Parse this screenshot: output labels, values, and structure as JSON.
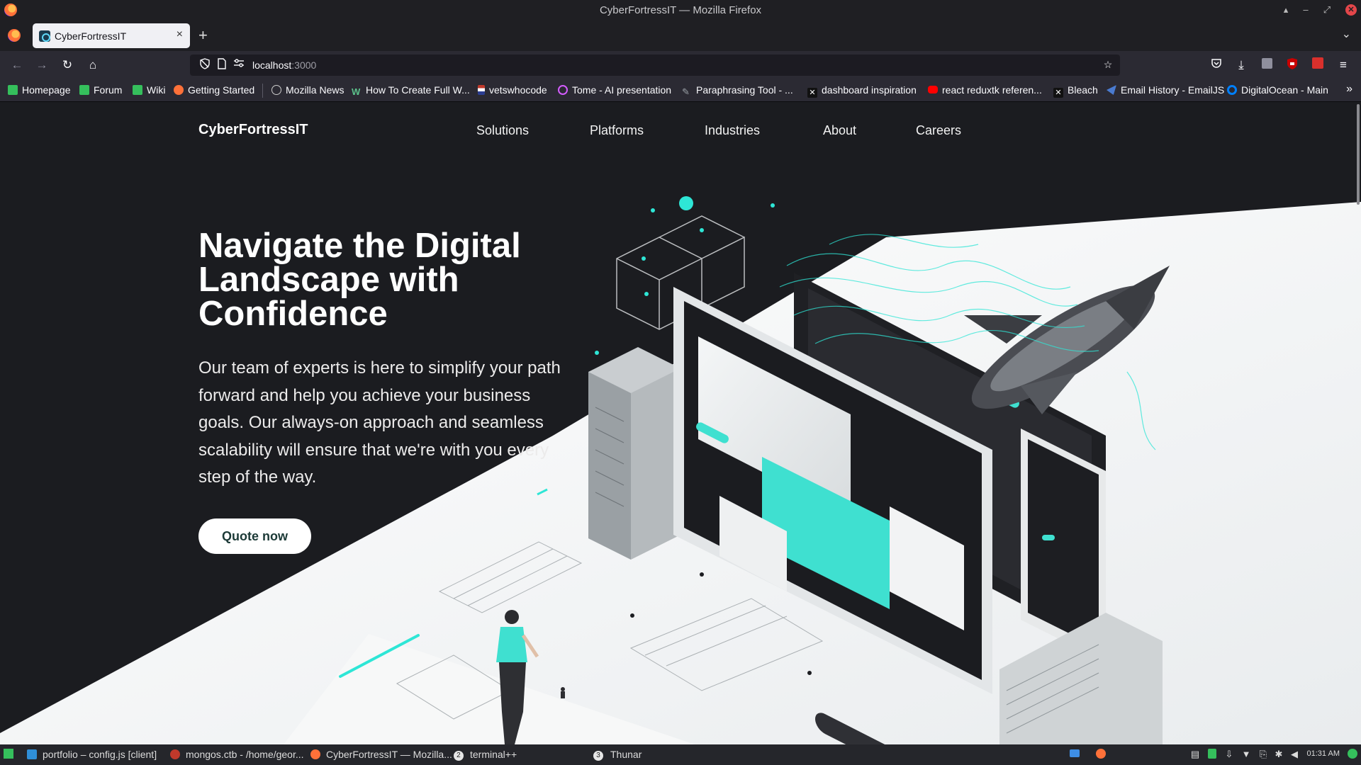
{
  "window": {
    "title": "CyberFortressIT — Mozilla Firefox",
    "controls": [
      "▴",
      "–",
      "⤢",
      "✕"
    ]
  },
  "tabs": [
    {
      "label": "CyberFortressIT",
      "favicon": "react-logo-icon",
      "active": true
    }
  ],
  "toolbar": {
    "back": "←",
    "forward": "→",
    "reload": "↻",
    "home": "⌂",
    "new_tab": "+",
    "tab_list": "⌄"
  },
  "urlbar": {
    "host": "localhost",
    "port": ":3000"
  },
  "bookmarks": [
    {
      "label": "Homepage",
      "icon": "manjaro-icon",
      "color": "#35bf5c"
    },
    {
      "label": "Forum",
      "icon": "manjaro-icon",
      "color": "#35bf5c"
    },
    {
      "label": "Wiki",
      "icon": "manjaro-icon",
      "color": "#35bf5c"
    },
    {
      "label": "Getting Started",
      "icon": "firefox-icon",
      "color": "#ff7139"
    },
    {
      "label": "Mozilla News",
      "icon": "globe-icon",
      "color": "#cccccc"
    },
    {
      "label": "How To Create Full W...",
      "icon": "w-icon",
      "color": "#5cc28b"
    },
    {
      "label": "vetswhocode",
      "icon": "flag-icon",
      "color": "#c0392b"
    },
    {
      "label": "Tome - AI presentation",
      "icon": "tome-icon",
      "color": "#d45cff"
    },
    {
      "label": "Paraphrasing Tool - ...",
      "icon": "quill-icon",
      "color": "#9aa0a6"
    },
    {
      "label": "dashboard inspiration",
      "icon": "x-icon",
      "color": "#111111"
    },
    {
      "label": "react reduxtk referen...",
      "icon": "youtube-icon",
      "color": "#ff0000"
    },
    {
      "label": "Bleach",
      "icon": "x-icon",
      "color": "#111111"
    },
    {
      "label": "Email History - EmailJS",
      "icon": "emailjs-icon",
      "color": "#4a7bd0"
    },
    {
      "label": "DigitalOcean - Main",
      "icon": "digitalocean-icon",
      "color": "#0080ff"
    }
  ],
  "site": {
    "brand": "CyberFortressIT",
    "nav": [
      "Solutions",
      "Platforms",
      "Industries",
      "About",
      "Careers"
    ],
    "hero_title": "Navigate the Digital Landscape with Confidence",
    "hero_text": "Our team of experts is here to simplify your path forward and help you achieve your business goals. Our always-on approach and seamless scalability will ensure that we're with you every step of the way.",
    "cta": "Quote now",
    "accent": "#2ee6d6"
  },
  "taskbar": {
    "tasks": [
      {
        "label": "portfolio – config.js [client]",
        "icon": "vscode-icon",
        "color": "#2f8fd8"
      },
      {
        "label": "mongos.ctb - /home/geor...",
        "icon": "cherrytree-icon",
        "color": "#c0392b"
      },
      {
        "label": "CyberFortressIT — Mozilla...",
        "icon": "firefox-icon",
        "color": "#ff7139",
        "badge": "2"
      },
      {
        "label": "terminal++",
        "icon": "terminal-icon",
        "color": "#dcdcdc"
      },
      {
        "label": "Thunar",
        "icon": "folder-icon",
        "color": "#dcdcdc",
        "badge_prefix": "3"
      }
    ],
    "clock": "01:31 AM"
  }
}
